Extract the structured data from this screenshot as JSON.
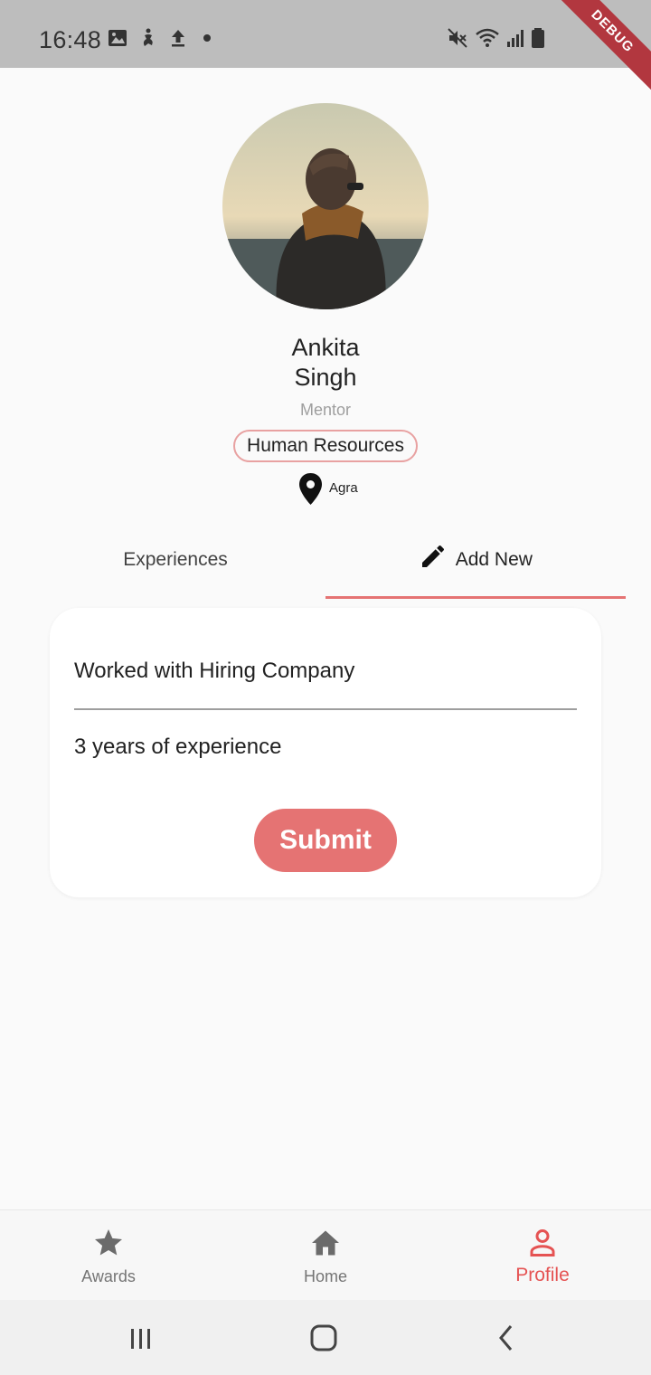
{
  "status_bar": {
    "time": "16:48",
    "left_icons": [
      "image-icon",
      "accessibility-icon",
      "upload-icon",
      "dot-icon"
    ],
    "right_icons": [
      "mute-icon",
      "wifi-icon",
      "signal-icon",
      "battery-icon"
    ],
    "debug_label": "DEBUG"
  },
  "profile": {
    "first_name": "Ankita",
    "last_name": "Singh",
    "role": "Mentor",
    "department": "Human Resources",
    "location": "Agra"
  },
  "tabs": [
    {
      "label": "Experiences",
      "active": false
    },
    {
      "label": "Add New",
      "active": true
    }
  ],
  "form": {
    "title_value": "Worked with Hiring Company",
    "description_value": "3 years of experience",
    "submit_label": "Submit"
  },
  "bottom_nav": [
    {
      "label": "Awards",
      "icon": "star-icon",
      "active": false
    },
    {
      "label": "Home",
      "icon": "home-icon",
      "active": false
    },
    {
      "label": "Profile",
      "icon": "person-icon",
      "active": true
    }
  ],
  "colors": {
    "accent": "#e57373",
    "active_nav": "#e55353",
    "chip_border": "#e8a1a1",
    "status_bar_bg": "#bdbdbd"
  }
}
